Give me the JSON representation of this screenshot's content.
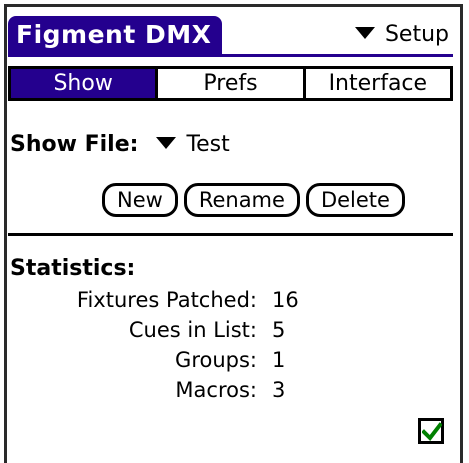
{
  "app": {
    "title": "Figment DMX"
  },
  "menu": {
    "setup_label": "Setup"
  },
  "tabs": [
    {
      "label": "Show",
      "active": true
    },
    {
      "label": "Prefs",
      "active": false
    },
    {
      "label": "Interface",
      "active": false
    }
  ],
  "show_file": {
    "label": "Show File:",
    "value": "Test"
  },
  "buttons": {
    "new": "New",
    "rename": "Rename",
    "delete": "Delete"
  },
  "statistics": {
    "title": "Statistics:",
    "rows": [
      {
        "label": "Fixtures Patched:",
        "value": "16"
      },
      {
        "label": "Cues in List:",
        "value": "5"
      },
      {
        "label": "Groups:",
        "value": "1"
      },
      {
        "label": "Macros:",
        "value": "3"
      }
    ]
  },
  "checkbox": {
    "checked": true,
    "check_color": "#008000"
  },
  "colors": {
    "accent": "#24008e"
  }
}
